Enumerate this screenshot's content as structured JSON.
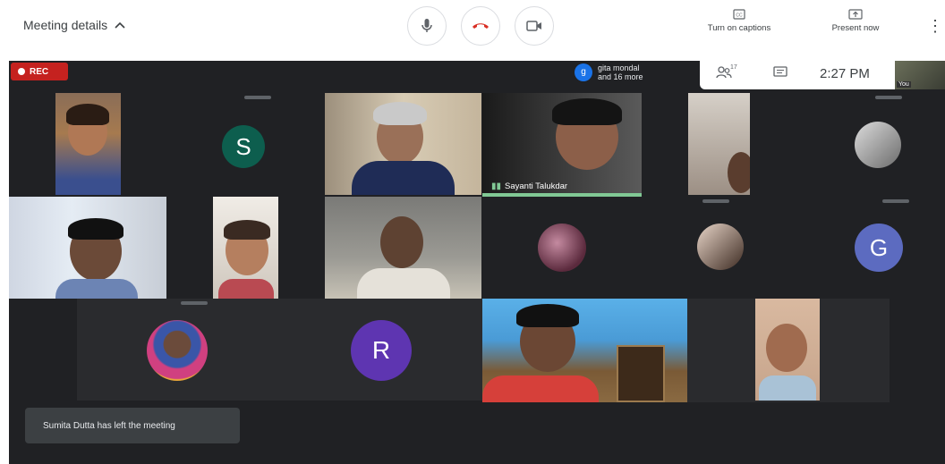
{
  "header": {
    "meeting_details_label": "Meeting details",
    "captions_label": "Turn on captions",
    "present_label": "Present now"
  },
  "controls": {
    "mic_icon": "mic-icon",
    "end_call_icon": "end-call-icon",
    "camera_icon": "camera-icon",
    "end_call_color": "#d93025"
  },
  "stage": {
    "rec_label": "REC",
    "join_notice": {
      "avatar_letter": "g",
      "line1": "gita mondal",
      "line2": "and 16 more"
    },
    "info_bar": {
      "people_count": "17",
      "time": "2:27 PM"
    },
    "self_label": "You",
    "speaker_name": "Sayanti Talukdar",
    "toast": "Sumita Dutta has left the meeting"
  },
  "tiles": [
    {
      "type": "video",
      "description": "woman in saree"
    },
    {
      "type": "avatar",
      "letter": "S",
      "color": "#0d5e4e"
    },
    {
      "type": "video",
      "description": "man with folded hands"
    },
    {
      "type": "video",
      "description": "woman with glasses (active speaker)",
      "speaking": true
    },
    {
      "type": "video",
      "description": "partial face"
    },
    {
      "type": "avatar-photo",
      "description": "man small circle"
    },
    {
      "type": "video",
      "description": "man with glasses"
    },
    {
      "type": "video",
      "description": "older woman"
    },
    {
      "type": "video",
      "description": "man sitting"
    },
    {
      "type": "avatar-photo",
      "description": "flowers circle"
    },
    {
      "type": "avatar-photo",
      "description": "woman circle"
    },
    {
      "type": "avatar",
      "letter": "G",
      "color": "#5c6bc0"
    },
    {
      "type": "avatar-photo",
      "description": "man on colored background"
    },
    {
      "type": "avatar",
      "letter": "R",
      "color": "#5e35b1"
    },
    {
      "type": "video",
      "description": "young man with headphones"
    },
    {
      "type": "video",
      "description": "older man with glasses"
    }
  ]
}
